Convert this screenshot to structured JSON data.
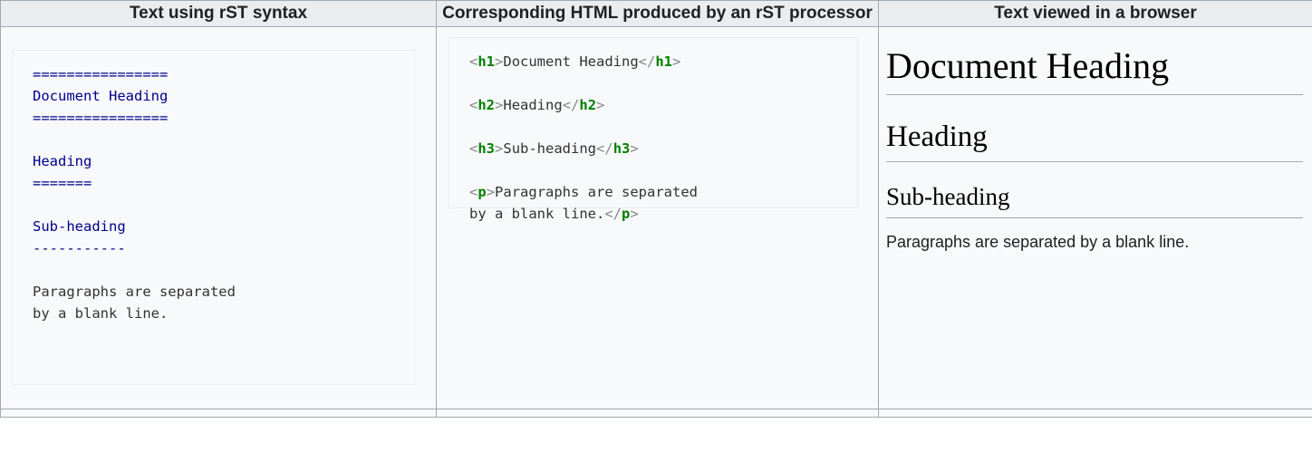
{
  "table": {
    "headers": [
      "Text using rST syntax",
      "Corresponding HTML produced by an rST processor",
      "Text viewed in a browser"
    ],
    "row": {
      "rst_source": {
        "doc_overline": "================",
        "doc_title": "Document Heading",
        "doc_underline": "================",
        "blank1": "",
        "h2_title": "Heading",
        "h2_underline": "=======",
        "blank2": "",
        "h3_title": "Sub-heading",
        "h3_underline": "-----------",
        "blank3": "",
        "paragraph_line1": "Paragraphs are separated",
        "paragraph_line2": "by a blank line."
      },
      "html_source": {
        "line1": {
          "open_lt": "<",
          "open_tag": "h1",
          "open_gt": ">",
          "text": "Document Heading",
          "close_lt": "</",
          "close_tag": "h1",
          "close_gt": ">"
        },
        "line2": {
          "open_lt": "<",
          "open_tag": "h2",
          "open_gt": ">",
          "text": "Heading",
          "close_lt": "</",
          "close_tag": "h2",
          "close_gt": ">"
        },
        "line3": {
          "open_lt": "<",
          "open_tag": "h3",
          "open_gt": ">",
          "text": "Sub-heading",
          "close_lt": "</",
          "close_tag": "h3",
          "close_gt": ">"
        },
        "line4": {
          "open_lt": "<",
          "open_tag": "p",
          "open_gt": ">",
          "text": "Paragraphs are separated\nby a blank line.",
          "close_lt": "</",
          "close_tag": "p",
          "close_gt": ">"
        }
      },
      "rendered": {
        "h1": "Document Heading",
        "h2": "Heading",
        "h3": "Sub-heading",
        "paragraph": "Paragraphs are separated by a blank line."
      }
    }
  },
  "colors": {
    "header_background": "#eaecf0",
    "cell_background": "#f8f9fa",
    "table_border": "#a2a9b1",
    "codebox_border": "#eaecf0",
    "rst_heading": "#00008b",
    "html_tag_name": "#008000",
    "html_bracket": "#888888",
    "body_text": "#202122"
  }
}
